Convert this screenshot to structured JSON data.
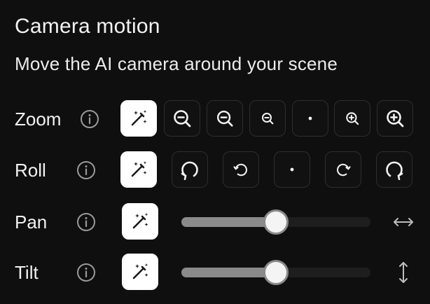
{
  "panel": {
    "title": "Camera motion",
    "subtitle": "Move the AI camera around your scene"
  },
  "controls": {
    "zoom": {
      "label": "Zoom",
      "info_icon": "info-icon",
      "auto_icon": "magic-wand-icon",
      "options": [
        {
          "name": "zoom-out-strong",
          "icon": "zoom-out-icon"
        },
        {
          "name": "zoom-out",
          "icon": "zoom-out-icon"
        },
        {
          "name": "zoom-out-slight",
          "icon": "zoom-out-icon"
        },
        {
          "name": "zoom-none",
          "icon": "dot-icon"
        },
        {
          "name": "zoom-in-slight",
          "icon": "zoom-in-icon"
        },
        {
          "name": "zoom-in-strong",
          "icon": "zoom-in-icon"
        }
      ]
    },
    "roll": {
      "label": "Roll",
      "info_icon": "info-icon",
      "auto_icon": "magic-wand-icon",
      "options": [
        {
          "name": "roll-left-strong",
          "icon": "rotate-ccw-icon"
        },
        {
          "name": "roll-left-slight",
          "icon": "rotate-ccw-icon"
        },
        {
          "name": "roll-none",
          "icon": "dot-icon"
        },
        {
          "name": "roll-right-slight",
          "icon": "rotate-cw-icon"
        },
        {
          "name": "roll-right-strong",
          "icon": "rotate-cw-icon"
        }
      ]
    },
    "pan": {
      "label": "Pan",
      "info_icon": "info-icon",
      "auto_icon": "magic-wand-icon",
      "value": 0.5,
      "axis_icon": "horizontal-arrows-icon"
    },
    "tilt": {
      "label": "Tilt",
      "info_icon": "info-icon",
      "auto_icon": "magic-wand-icon",
      "value": 0.5,
      "axis_icon": "vertical-arrows-icon"
    }
  },
  "colors": {
    "background": "#0f0f0f",
    "button_border": "#2e2e2e",
    "auto_button": "#ffffff",
    "slider_fill": "#8a8a8a",
    "slider_track": "#1e1e1e"
  }
}
